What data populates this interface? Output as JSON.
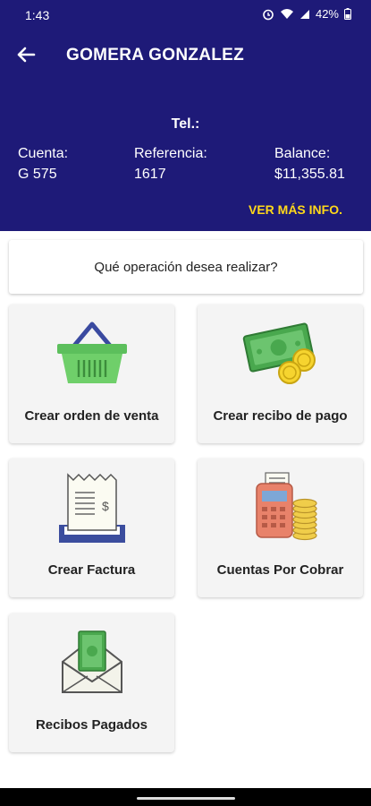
{
  "status": {
    "time": "1:43",
    "battery": "42%"
  },
  "header": {
    "title": "GOMERA GONZALEZ"
  },
  "info": {
    "tel_label": "Tel.:",
    "account_label": "Cuenta:",
    "account_value": "G 575",
    "reference_label": "Referencia:",
    "reference_value": "1617",
    "balance_label": "Balance:",
    "balance_value": "$11,355.81",
    "more_link": "VER MÁS INFO."
  },
  "question": "Qué operación desea realizar?",
  "operations": [
    {
      "label": "Crear orden de venta",
      "icon": "basket-icon"
    },
    {
      "label": "Crear recibo de pago",
      "icon": "cash-coins-icon"
    },
    {
      "label": "Crear Factura",
      "icon": "invoice-icon"
    },
    {
      "label": "Cuentas Por Cobrar",
      "icon": "pos-terminal-icon"
    },
    {
      "label": "Recibos Pagados",
      "icon": "envelope-money-icon"
    }
  ],
  "colors": {
    "primary": "#1e1a78",
    "accent": "#ffd81a",
    "card": "#f4f4f4"
  }
}
